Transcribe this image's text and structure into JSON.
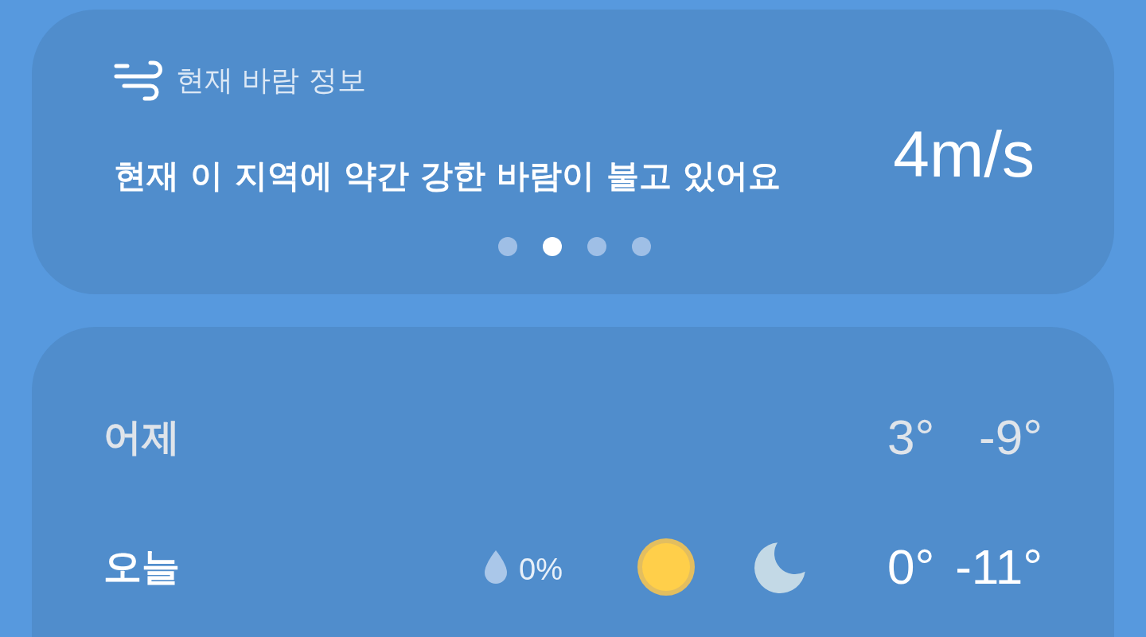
{
  "wind_card": {
    "title": "현재 바람 정보",
    "message": "현재 이 지역에 약간 강한 바람이 불고 있어요",
    "speed": "4m/s",
    "pages": [
      {
        "selected": false
      },
      {
        "selected": true
      },
      {
        "selected": false
      },
      {
        "selected": false
      }
    ]
  },
  "forecast": {
    "days": [
      {
        "kind": "past",
        "label": "어제",
        "high": "3°",
        "low": "-9°"
      },
      {
        "kind": "current",
        "label": "오늘",
        "precipitation": "0%",
        "high": "0°",
        "low": "-11°"
      }
    ]
  }
}
